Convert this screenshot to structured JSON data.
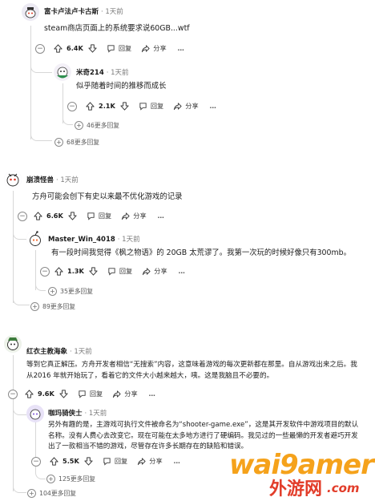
{
  "comments": [
    {
      "user": "富卡卢法卢卡古斯",
      "time": "1天前",
      "text": "steam商店页面上的系统要求说60GB...wtf",
      "votes": "6.4K",
      "reply_label": "回复",
      "share_label": "分享",
      "more_icon": "…",
      "replies": [
        {
          "user": "米奇214",
          "time": "1天前",
          "text": "似乎随着时间的推移而成长",
          "votes": "2.1K",
          "reply_label": "回复",
          "share_label": "分享",
          "more_icon": "…"
        }
      ],
      "nested_more": "46更多回复",
      "more_replies": "68更多回复"
    },
    {
      "user": "崩溃怪兽",
      "time": "1天前",
      "text": "方舟可能会创下有史以来最不优化游戏的记录",
      "votes": "6.6K",
      "reply_label": "回复",
      "share_label": "分享",
      "more_icon": "…",
      "replies": [
        {
          "user": "Master_Win_4018",
          "time": "1天前",
          "text": "有一段时间我觉得《枫之物语》的 20GB 太荒谬了。我第一次玩的时候好像只有300mb。",
          "votes": "1.3K",
          "reply_label": "回复",
          "share_label": "分享",
          "more_icon": "…"
        }
      ],
      "nested_more": "35更多回复",
      "more_replies": "89更多回复"
    },
    {
      "user": "红衣主教海象",
      "time": "1天前",
      "text": "等到它真正解压。方舟开发者相信“无搜索”内容，这意味着游戏的每次更新都在那里。自从游戏出来之后。我从2016 年就开始玩了，看着它的文件大小越来越大，咦。这是我脑且不必要的。",
      "votes": "9.6K",
      "reply_label": "回复",
      "share_label": "分享",
      "more_icon": "…",
      "replies": [
        {
          "user": "咖玛骑侠士",
          "time": "1天前",
          "text": "另外有趣的是，主游戏可执行文件被命名为“shooter-game.exe”，这是其开发软件中游戏项目的默认名称。没有人费心去改变它。现在可能在太多地方进行了硬编码。我见过的一些最懒的开发者避巧开发出了一款相当不错的游戏，尽管存在许多长期存在的缺陷和错误。",
          "votes": "5.5K",
          "reply_label": "回复",
          "share_label": "分享",
          "more_icon": "…"
        }
      ],
      "nested_more": "125更多回复",
      "more_replies": "104更多回复"
    }
  ],
  "watermark": {
    "latin": "wai9amer",
    "domain": ".com",
    "cjk": "外游网",
    "color_orange": "#f5a21b",
    "color_red": "#e23d2a"
  },
  "colors": {
    "thread": "#d7d7d7",
    "text": "#1c1c1c",
    "meta": "#7c7c7c"
  }
}
